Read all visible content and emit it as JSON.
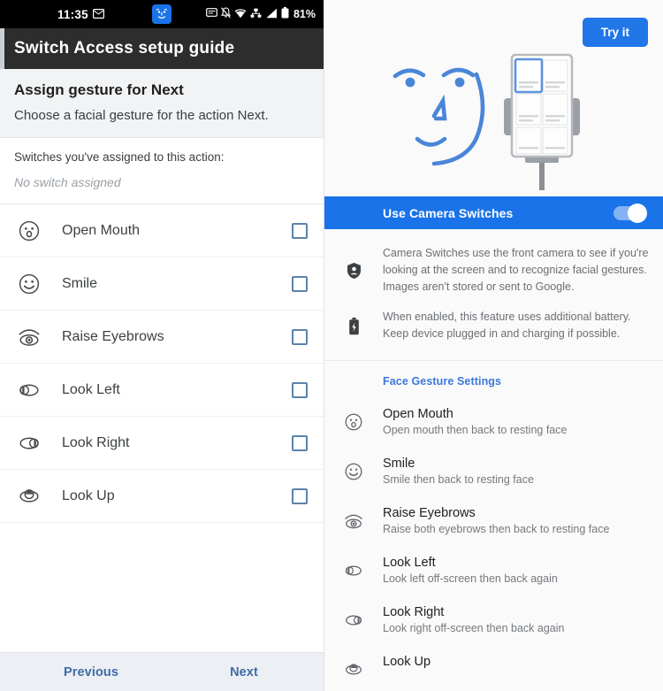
{
  "left": {
    "statusbar": {
      "time": "11:35",
      "mail_icon": "mail-icon",
      "center_icon": "camera-switches-face-icon",
      "icons": [
        "message-icon",
        "notifications-off-icon",
        "wifi-icon",
        "vpn-icon",
        "signal-icon",
        "battery-icon"
      ],
      "battery_percent": "81%"
    },
    "appbar": {
      "title": "Switch Access setup guide"
    },
    "section": {
      "title": "Assign gesture for Next",
      "subtitle": "Choose a facial gesture for the action Next."
    },
    "assigned": {
      "label": "Switches you've assigned to this action:",
      "value": "No switch assigned"
    },
    "gestures": [
      {
        "icon": "open-mouth-icon",
        "label": "Open Mouth",
        "checked": false
      },
      {
        "icon": "smile-icon",
        "label": "Smile",
        "checked": false
      },
      {
        "icon": "raise-eyebrows-icon",
        "label": "Raise Eyebrows",
        "checked": false
      },
      {
        "icon": "look-left-icon",
        "label": "Look Left",
        "checked": false
      },
      {
        "icon": "look-right-icon",
        "label": "Look Right",
        "checked": false
      },
      {
        "icon": "look-up-icon",
        "label": "Look Up",
        "checked": false
      }
    ],
    "bottombar": {
      "previous": "Previous",
      "next": "Next"
    }
  },
  "right": {
    "hero": {
      "try_button": "Try it",
      "illustration": "face-and-phone-on-stand-illustration"
    },
    "toggle": {
      "label": "Use Camera Switches",
      "enabled": true
    },
    "info": [
      {
        "icon": "privacy-shield-icon",
        "text": "Camera Switches use the front camera to see if you're looking at the screen and to recognize facial gestures. Images aren't stored or sent to Google."
      },
      {
        "icon": "battery-charging-icon",
        "text": "When enabled, this feature uses additional battery. Keep device plugged in and charging if possible."
      }
    ],
    "face_gesture_settings": {
      "title": "Face Gesture Settings",
      "items": [
        {
          "icon": "open-mouth-icon",
          "title": "Open Mouth",
          "subtitle": "Open mouth then back to resting face"
        },
        {
          "icon": "smile-icon",
          "title": "Smile",
          "subtitle": "Smile then back to resting face"
        },
        {
          "icon": "raise-eyebrows-icon",
          "title": "Raise Eyebrows",
          "subtitle": "Raise both eyebrows then back to resting face"
        },
        {
          "icon": "look-left-icon",
          "title": "Look Left",
          "subtitle": "Look left off-screen then back again"
        },
        {
          "icon": "look-right-icon",
          "title": "Look Right",
          "subtitle": "Look right off-screen then back again"
        },
        {
          "icon": "look-up-icon",
          "title": "Look Up",
          "subtitle": ""
        }
      ]
    }
  },
  "colors": {
    "accent_blue": "#1a73e8",
    "button_blue": "#2176e8",
    "link_blue": "#3b78dc",
    "appbar_dark": "#2d2d2d",
    "statusbar_black": "#000000",
    "checkbox_border": "#5c83ab",
    "bottom_button": "#3f6ca8",
    "illustration_blue": "#4a86d8",
    "illustration_gray": "#9aa0a6"
  }
}
